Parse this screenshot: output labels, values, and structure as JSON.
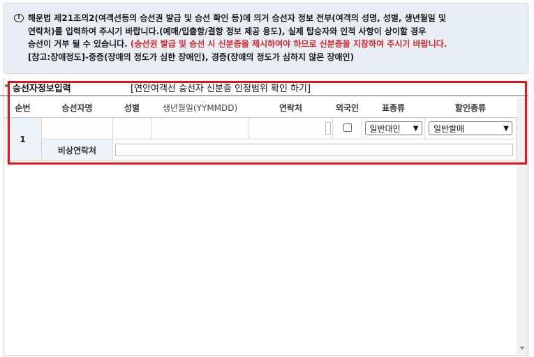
{
  "notice": {
    "icon": "warning-circle-icon",
    "line1": "해운법 제21조의2(여객선등의 승선권 발급 및 승선 확인 등)에 의거 승선자 정보 전부(여객의 성명, 성별, 생년월일 및",
    "line2": "연락처)를 입력하여 주시기 바랍니다.(예매/입출항/결항 정보 제공 용도), 실제 탑승자와 인적 사항이 상이할 경우",
    "line3a": "승선이 거부 될 수 있습니다. ",
    "line3b": "(승선권 발급 및 승선 시 신분증을 제시하여야 하므로 신분증을 지참하여 주시기 바랍니다.",
    "line4": "[참고:장애정도]-중증(장애의 정도가 심한 장애인), 경증(장애의 정도가 심하지 않은 장애인)"
  },
  "section": {
    "title": "승선자정보입력",
    "link": "[연안여객선 승선자 신분증 인정범위 확인 하기]"
  },
  "table": {
    "headers": [
      "순번",
      "승선자명",
      "성별",
      "생년월일(YYMMDD)",
      "연락처",
      "외국인",
      "표종류",
      "할인종류"
    ],
    "row": {
      "seq": "1",
      "ticket_type": "일반대인",
      "discount_type": "일반발매",
      "emergency_label": "비상연락처"
    }
  },
  "colors": {
    "highlight": "#e8141c",
    "notice_bg": "#e9eef4",
    "red_text": "#d6262a"
  }
}
